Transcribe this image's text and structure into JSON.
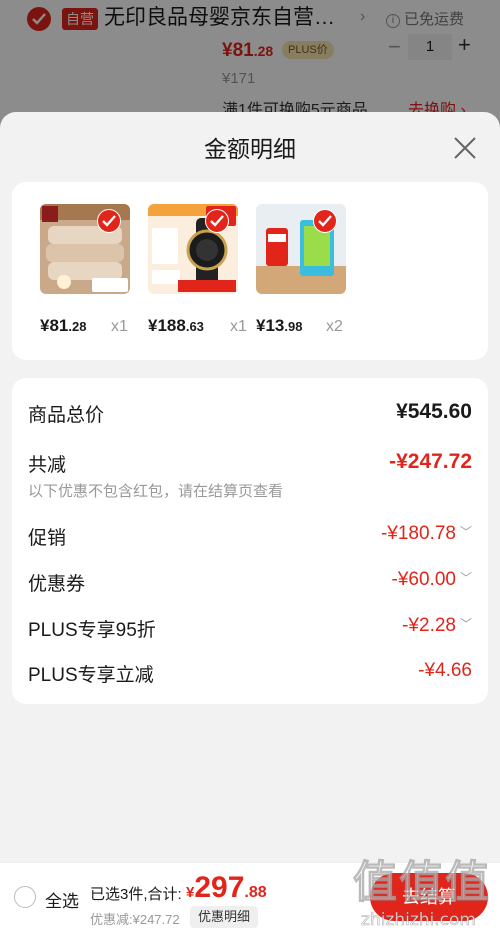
{
  "background_item": {
    "store_tag": "自营",
    "title": "无印良品母婴京东自营…",
    "shipping": "已免运费",
    "price_int": "¥81",
    "price_dec": ".28",
    "plus_tag": "PLUS价",
    "quantity": "1",
    "original_price": "¥171",
    "promo": "满1件可换购5元商品",
    "swap_link": "去换购 ›"
  },
  "sheet": {
    "title": "金额明细",
    "products": [
      {
        "price_int": "¥81",
        "price_dec": ".28",
        "qty": "x1",
        "image": "blanket"
      },
      {
        "price_int": "¥188",
        "price_dec": ".63",
        "qty": "x1",
        "image": "watch"
      },
      {
        "price_int": "¥13",
        "price_dec": ".98",
        "qty": "x2",
        "image": "toothpaste"
      }
    ],
    "rows": {
      "total_label": "商品总价",
      "total_value": "¥545.60",
      "reduce_label": "共减",
      "reduce_value": "-¥247.72",
      "reduce_note": "以下优惠不包含红包，请在结算页查看",
      "promo_label": "促销",
      "promo_value": "-¥180.78",
      "coupon_label": "优惠券",
      "coupon_value": "-¥60.00",
      "plus95_label": "PLUS专享95折",
      "plus95_value": "-¥2.28",
      "plusred_label": "PLUS专享立减",
      "plusred_value": "-¥4.66"
    }
  },
  "bottom_bar": {
    "select_all": "全选",
    "summary": "已选3件,合计:",
    "total_cur": "¥",
    "total_int": "297",
    "total_dec": ".88",
    "saved": "优惠减:¥247.72",
    "detail_button": "优惠明细",
    "checkout": "去结算"
  },
  "watermark": {
    "text": "值",
    "site": "zhizhizhi.com"
  },
  "colors": {
    "accent": "#e1251b",
    "muted": "#999999"
  }
}
